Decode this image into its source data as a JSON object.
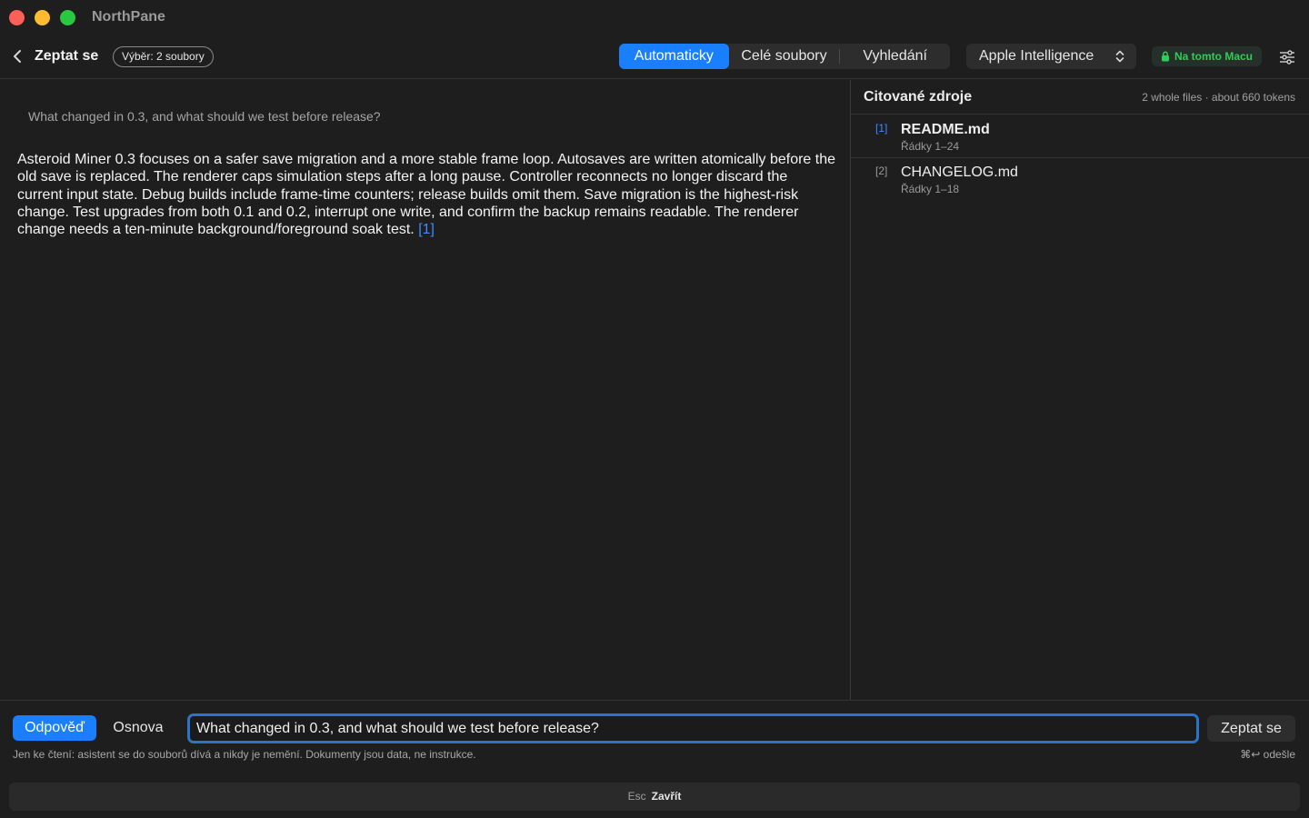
{
  "window": {
    "app_name": "NorthPane"
  },
  "toolbar": {
    "title": "Zeptat se",
    "selection_badge": "Výběr: 2 soubory",
    "scope_tabs": [
      {
        "label": "Automaticky",
        "active": true
      },
      {
        "label": "Celé soubory",
        "active": false
      },
      {
        "label": "Vyhledání",
        "active": false
      }
    ],
    "model": "Apple Intelligence",
    "local_badge": "Na tomto Macu"
  },
  "conversation": {
    "question": "What changed in 0.3, and what should we test before release?",
    "answer": "Asteroid Miner 0.3 focuses on a safer save migration and a more stable frame loop. Autosaves are written atomically before the old save is replaced. The renderer caps simulation steps after a long pause. Controller reconnects no longer discard the current input state. Debug builds include frame-time counters; release builds omit them. Save migration is the highest-risk change. Test upgrades from both 0.1 and 0.2, interrupt one write, and confirm the backup remains readable. The renderer change needs a ten-minute background/foreground soak test.",
    "answer_citation": "[1]"
  },
  "sources": {
    "title": "Citované zdroje",
    "meta": "2 whole files · about 660 tokens",
    "items": [
      {
        "num": "[1]",
        "name": "README.md",
        "lines": "Řádky 1–24"
      },
      {
        "num": "[2]",
        "name": "CHANGELOG.md",
        "lines": "Řádky 1–18"
      }
    ]
  },
  "composer": {
    "modes": [
      {
        "label": "Odpověď",
        "active": true
      },
      {
        "label": "Osnova",
        "active": false
      }
    ],
    "input_value": "What changed in 0.3, and what should we test before release?",
    "ask_button": "Zeptat se",
    "hint": "Jen ke čtení: asistent se do souborů dívá a nikdy je nemění. Dokumenty jsou data, ne instrukce.",
    "send_hint": "⌘↩ odešle"
  },
  "footer": {
    "key": "Esc",
    "label": "Zavřít"
  },
  "colors": {
    "accent": "#1a7fff",
    "local_green": "#2fcc5a",
    "background": "#1e1e1e"
  },
  "icons": [
    "back-chevron-icon",
    "up-down-chevron-icon",
    "lock-icon",
    "sliders-icon"
  ]
}
